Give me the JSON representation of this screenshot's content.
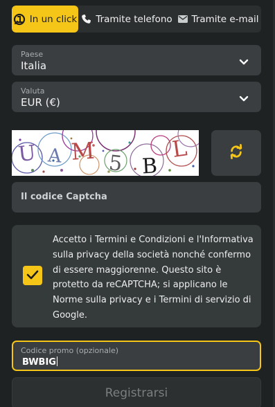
{
  "tabs": [
    {
      "label": "In un click",
      "icon": "one-click-icon",
      "active": true
    },
    {
      "label": "Tramite telefono",
      "icon": "phone-icon",
      "active": false
    },
    {
      "label": "Tramite e-mail",
      "icon": "envelope-icon",
      "active": false
    }
  ],
  "country": {
    "label": "Paese",
    "value": "Italia"
  },
  "currency": {
    "label": "Valuta",
    "value": "EUR (€)"
  },
  "captcha": {
    "image_text": "UAM5BL",
    "refresh_icon": "refresh-icon",
    "placeholder": "Il codice Captcha"
  },
  "terms": {
    "checked": true,
    "text": "Accetto i Termini e Condizioni e l'Informativa sulla privacy della società nonché confermo di essere maggiorenne. Questo sito è protetto da reCAPTCHA; si applicano le Norme sulla privacy e i Termini di servizio di Google."
  },
  "promo": {
    "label": "Codice promo (opzionale)",
    "value": "BWBIG"
  },
  "submit": {
    "label": "Registrarsi"
  },
  "colors": {
    "accent": "#f5c518",
    "background": "#1f2222",
    "field": "#3a3e40"
  }
}
